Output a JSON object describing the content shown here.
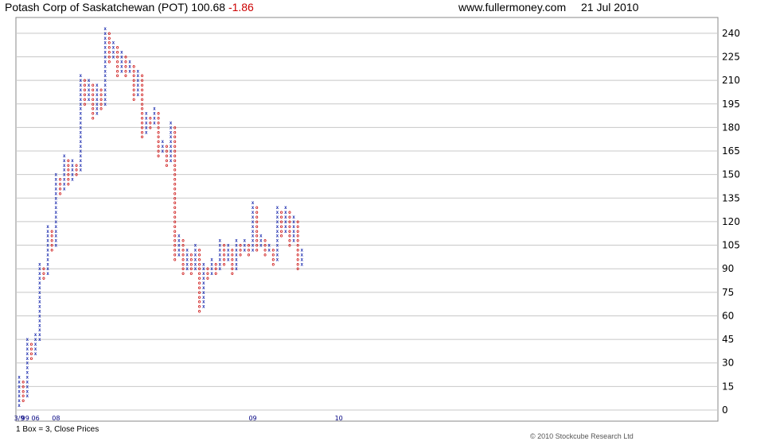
{
  "header": {
    "title": "Potash Corp of Saskatchewan (POT) 100.68",
    "change": "-1.86",
    "site": "www.fullermoney.com",
    "date": "21 Jul 2010"
  },
  "footer": {
    "box_note": "1 Box = 3, Close Prices",
    "copyright": "© 2010 Stockcube Research Ltd"
  },
  "chart_data": {
    "type": "point-and-figure",
    "box_size": 3,
    "ylim": [
      0,
      246
    ],
    "yticks": [
      0,
      15,
      30,
      45,
      60,
      75,
      90,
      105,
      120,
      135,
      150,
      165,
      180,
      195,
      210,
      225,
      240
    ],
    "grid": "horizontal",
    "colors": {
      "x": "#1f2fb0",
      "o": "#cc1111",
      "grid": "#c8c8c8",
      "frame": "#888888"
    },
    "x_labels": [
      {
        "label": "3/9",
        "col": 0
      },
      {
        "label": "9",
        "col": 1
      },
      {
        "label": "9",
        "col": 2
      },
      {
        "label": "06",
        "col": 4
      },
      {
        "label": "08",
        "col": 9
      },
      {
        "label": "09",
        "col": 57
      },
      {
        "label": "10",
        "col": 78
      }
    ],
    "columns": [
      {
        "type": "X",
        "from": 3,
        "to": 21
      },
      {
        "type": "O",
        "from": 18,
        "to": 6
      },
      {
        "type": "X",
        "from": 9,
        "to": 45
      },
      {
        "type": "O",
        "from": 42,
        "to": 33
      },
      {
        "type": "X",
        "from": 36,
        "to": 48
      },
      {
        "type": "X",
        "from": 45,
        "to": 93
      },
      {
        "type": "O",
        "from": 90,
        "to": 84
      },
      {
        "type": "X",
        "from": 87,
        "to": 117
      },
      {
        "type": "O",
        "from": 114,
        "to": 102
      },
      {
        "type": "X",
        "from": 105,
        "to": 150
      },
      {
        "type": "O",
        "from": 147,
        "to": 138
      },
      {
        "type": "X",
        "from": 141,
        "to": 162
      },
      {
        "type": "O",
        "from": 159,
        "to": 144
      },
      {
        "type": "X",
        "from": 147,
        "to": 159
      },
      {
        "type": "O",
        "from": 156,
        "to": 150
      },
      {
        "type": "X",
        "from": 153,
        "to": 213
      },
      {
        "type": "O",
        "from": 210,
        "to": 195
      },
      {
        "type": "X",
        "from": 198,
        "to": 210
      },
      {
        "type": "O",
        "from": 207,
        "to": 186
      },
      {
        "type": "X",
        "from": 189,
        "to": 207
      },
      {
        "type": "O",
        "from": 204,
        "to": 192
      },
      {
        "type": "X",
        "from": 195,
        "to": 243
      },
      {
        "type": "O",
        "from": 240,
        "to": 222
      },
      {
        "type": "X",
        "from": 225,
        "to": 234
      },
      {
        "type": "O",
        "from": 231,
        "to": 213
      },
      {
        "type": "X",
        "from": 216,
        "to": 228
      },
      {
        "type": "O",
        "from": 225,
        "to": 213
      },
      {
        "type": "X",
        "from": 216,
        "to": 222
      },
      {
        "type": "O",
        "from": 219,
        "to": 198
      },
      {
        "type": "X",
        "from": 201,
        "to": 216
      },
      {
        "type": "O",
        "from": 213,
        "to": 174
      },
      {
        "type": "X",
        "from": 177,
        "to": 189
      },
      {
        "type": "O",
        "from": 186,
        "to": 180
      },
      {
        "type": "X",
        "from": 183,
        "to": 192
      },
      {
        "type": "O",
        "from": 189,
        "to": 162
      },
      {
        "type": "X",
        "from": 165,
        "to": 171
      },
      {
        "type": "O",
        "from": 168,
        "to": 156
      },
      {
        "type": "X",
        "from": 159,
        "to": 183
      },
      {
        "type": "O",
        "from": 180,
        "to": 96
      },
      {
        "type": "X",
        "from": 99,
        "to": 111
      },
      {
        "type": "O",
        "from": 108,
        "to": 87
      },
      {
        "type": "X",
        "from": 90,
        "to": 102
      },
      {
        "type": "O",
        "from": 99,
        "to": 87
      },
      {
        "type": "X",
        "from": 90,
        "to": 105
      },
      {
        "type": "O",
        "from": 102,
        "to": 63
      },
      {
        "type": "X",
        "from": 66,
        "to": 93
      },
      {
        "type": "O",
        "from": 90,
        "to": 84
      },
      {
        "type": "X",
        "from": 87,
        "to": 96
      },
      {
        "type": "O",
        "from": 93,
        "to": 87
      },
      {
        "type": "X",
        "from": 90,
        "to": 108
      },
      {
        "type": "O",
        "from": 105,
        "to": 93
      },
      {
        "type": "X",
        "from": 96,
        "to": 105
      },
      {
        "type": "O",
        "from": 102,
        "to": 87
      },
      {
        "type": "X",
        "from": 90,
        "to": 108
      },
      {
        "type": "O",
        "from": 105,
        "to": 99
      },
      {
        "type": "X",
        "from": 102,
        "to": 108
      },
      {
        "type": "O",
        "from": 105,
        "to": 99
      },
      {
        "type": "X",
        "from": 102,
        "to": 132
      },
      {
        "type": "O",
        "from": 129,
        "to": 102
      },
      {
        "type": "X",
        "from": 105,
        "to": 111
      },
      {
        "type": "O",
        "from": 108,
        "to": 99
      },
      {
        "type": "X",
        "from": 102,
        "to": 105
      },
      {
        "type": "O",
        "from": 102,
        "to": 93
      },
      {
        "type": "X",
        "from": 96,
        "to": 129
      },
      {
        "type": "O",
        "from": 126,
        "to": 111
      },
      {
        "type": "X",
        "from": 114,
        "to": 129
      },
      {
        "type": "O",
        "from": 126,
        "to": 105
      },
      {
        "type": "X",
        "from": 108,
        "to": 123
      },
      {
        "type": "O",
        "from": 120,
        "to": 90
      },
      {
        "type": "X",
        "from": 93,
        "to": 102
      }
    ]
  }
}
